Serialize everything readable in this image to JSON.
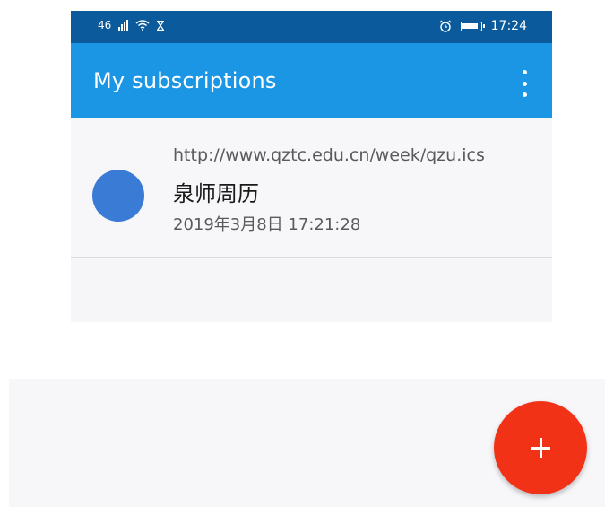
{
  "status_bar": {
    "network": "46",
    "time": "17:24",
    "icons": [
      "signal-icon",
      "wifi-icon",
      "hourglass-icon",
      "alarm-icon",
      "battery-icon"
    ]
  },
  "app_bar": {
    "title": "My subscriptions",
    "menu_icon": "more-vert-icon",
    "color": "#1a96e5"
  },
  "subscriptions": [
    {
      "url": "http://www.qztc.edu.cn/week/qzu.ics",
      "name": "泉师周历",
      "date": "2019年3月8日 17:21:28",
      "color": "#3a7bd5"
    }
  ],
  "fab": {
    "icon": "add-icon",
    "color": "#f23217"
  }
}
